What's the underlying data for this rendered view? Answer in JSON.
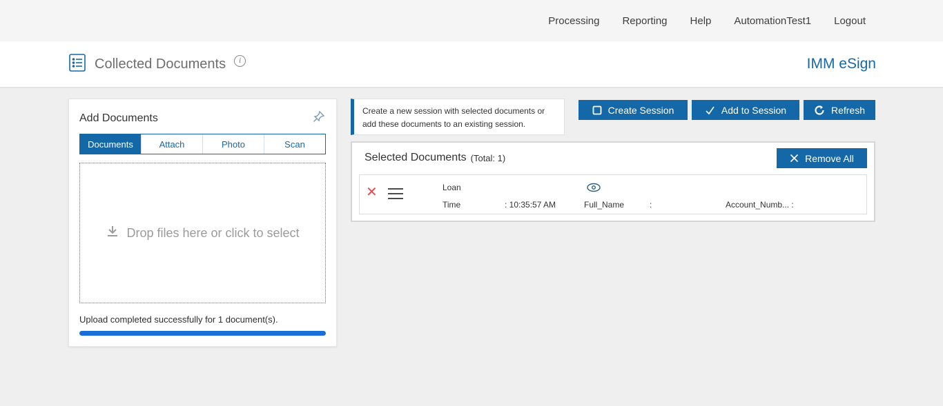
{
  "colors": {
    "accent": "#1568a7",
    "progress_blue": "#1a6ed8",
    "danger_red": "#e04f4f"
  },
  "top_nav": {
    "items": [
      "Processing",
      "Reporting",
      "Help",
      "AutomationTest1",
      "Logout"
    ]
  },
  "header": {
    "title": "Collected Documents",
    "info_icon": "i",
    "brand": "IMM eSign"
  },
  "add_documents": {
    "title": "Add Documents",
    "tabs": [
      {
        "label": "Documents",
        "active": true
      },
      {
        "label": "Attach",
        "active": false
      },
      {
        "label": "Photo",
        "active": false
      },
      {
        "label": "Scan",
        "active": false
      }
    ],
    "dropzone_text": "Drop files here or click to select",
    "status_text": "Upload completed successfully for 1 document(s).",
    "progress_percent": 100
  },
  "session": {
    "info_message": "Create a new session with selected documents or add these documents to an existing session.",
    "buttons": {
      "create_session": "Create Session",
      "add_to_session": "Add to Session",
      "refresh": "Refresh"
    }
  },
  "selected_documents": {
    "title": "Selected Documents",
    "total_label": "(Total: 1)",
    "remove_all": "Remove All",
    "rows": [
      {
        "name": "Loan",
        "time_label": "Time",
        "time_value": ": 10:35:57 AM",
        "full_name_label": "Full_Name",
        "full_name_colon": ":",
        "account_label": "Account_Numb... :"
      }
    ]
  }
}
